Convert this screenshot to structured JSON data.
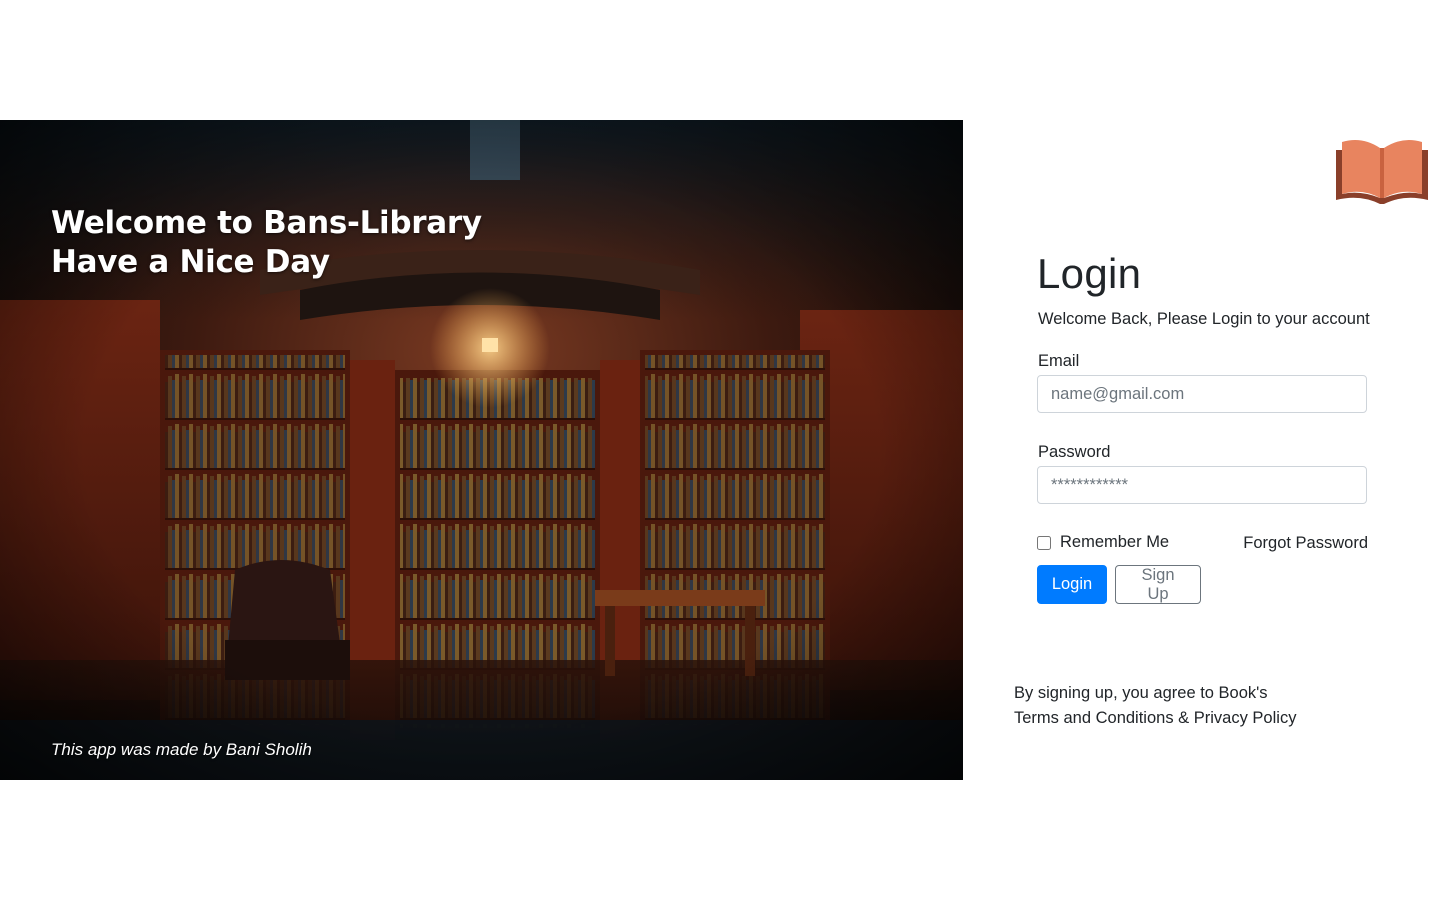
{
  "hero": {
    "title_line1": "Welcome to Bans-Library",
    "title_line2": "Have a Nice Day",
    "credit": "This app was made by Bani Sholih",
    "image_alt": "library-interior-image"
  },
  "logo": {
    "icon": "open-book-icon",
    "color": "#e8845f"
  },
  "login": {
    "title": "Login",
    "subtitle": "Welcome Back, Please Login to your account",
    "email_label": "Email",
    "email_placeholder": "name@gmail.com",
    "password_label": "Password",
    "password_placeholder": "************",
    "remember_label": "Remember Me",
    "remember_checked": false,
    "forgot_label": "Forgot Password",
    "login_button": "Login",
    "signup_button": "Sign Up"
  },
  "terms": {
    "line1": "By signing up, you agree to Book's",
    "line2": "Terms and Conditions & Privacy Policy"
  },
  "colors": {
    "primary": "#007bff",
    "secondary": "#6c757d",
    "text": "#212529"
  }
}
